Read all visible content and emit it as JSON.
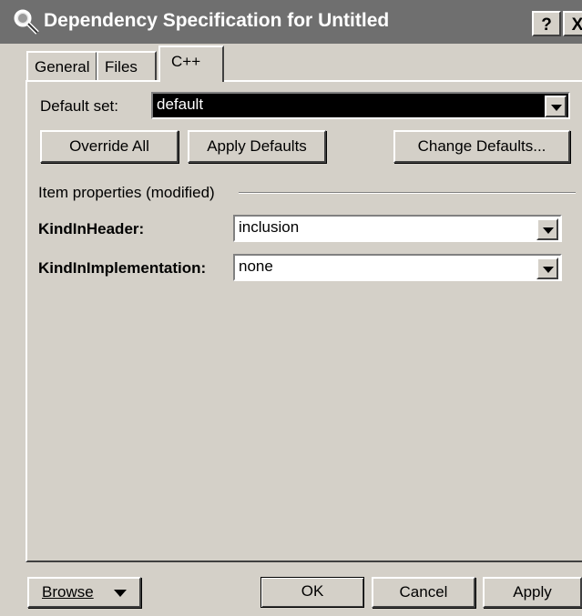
{
  "window": {
    "title": "Dependency Specification for Untitled"
  },
  "titlebar_buttons": {
    "help": "?",
    "close": "X"
  },
  "tabs": [
    {
      "label": "General"
    },
    {
      "label": "Files"
    },
    {
      "label": "C++"
    }
  ],
  "default_set": {
    "label": "Default set:",
    "value": "default"
  },
  "buttons": {
    "override_all": "Override All",
    "apply_defaults": "Apply Defaults",
    "change_defaults": "Change Defaults..."
  },
  "item_properties": {
    "group_label": "Item properties (modified)",
    "kind_in_header": {
      "label": "KindInHeader:",
      "value": "inclusion"
    },
    "kind_in_implementation": {
      "label": "KindInImplementation:",
      "value": "none"
    }
  },
  "footer": {
    "browse": "Browse",
    "ok": "OK",
    "cancel": "Cancel",
    "apply": "Apply"
  }
}
